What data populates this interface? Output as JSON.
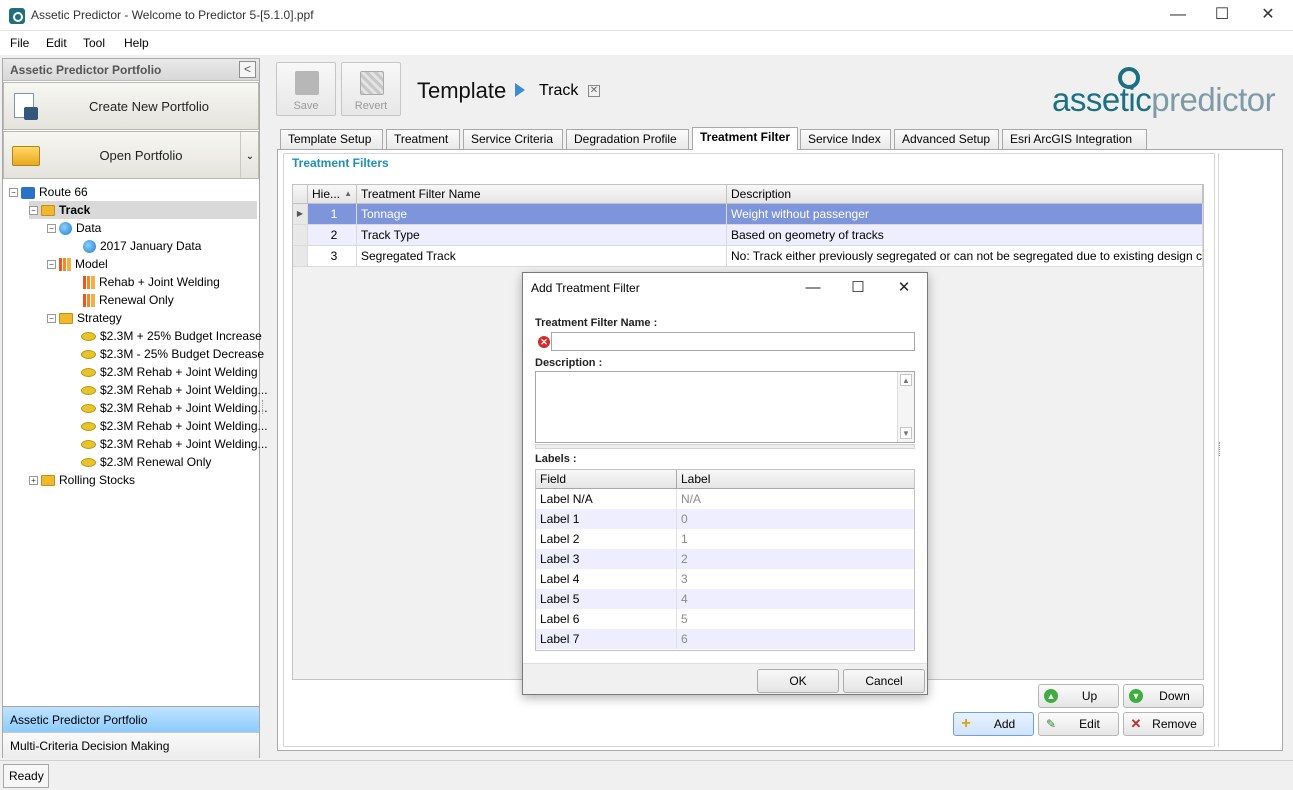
{
  "window": {
    "title": "Assetic Predictor - Welcome to Predictor 5-[5.1.0].ppf",
    "minimize": "—",
    "maximize": "☐",
    "close": "✕"
  },
  "menu": [
    "File",
    "Edit",
    "Tool",
    "Help"
  ],
  "left_panel": {
    "header": "Assetic Predictor Portfolio",
    "collapse_glyph": "<",
    "create_button": "Create New Portfolio",
    "open_button": "Open Portfolio",
    "tree": {
      "root": "Route 66",
      "track": "Track",
      "data": "Data",
      "data_item": "2017 January Data",
      "model": "Model",
      "model_items": [
        "Rehab + Joint Welding",
        "Renewal Only"
      ],
      "strategy": "Strategy",
      "strategy_items": [
        "$2.3M + 25% Budget Increase",
        "$2.3M - 25% Budget Decrease",
        "$2.3M Rehab + Joint Welding",
        "$2.3M Rehab + Joint Welding...",
        "$2.3M Rehab + Joint Welding...",
        "$2.3M Rehab + Joint Welding...",
        "$2.3M Rehab + Joint Welding...",
        "$2.3M Renewal Only"
      ],
      "rolling": "Rolling Stocks"
    },
    "nav": [
      "Assetic Predictor Portfolio",
      "Multi-Criteria Decision Making"
    ]
  },
  "toolbar": {
    "save": "Save",
    "revert": "Revert"
  },
  "breadcrumb": {
    "template": "Template",
    "item": "Track",
    "close": "✕"
  },
  "logo": {
    "part1": "assetic",
    "part2": "predictor"
  },
  "tabs": [
    "Template Setup",
    "Treatment",
    "Service Criteria",
    "Degradation Profile",
    "Treatment Filter",
    "Service Index",
    "Advanced Setup",
    "Esri ArcGIS Integration"
  ],
  "active_tab": "Treatment Filter",
  "section_title": "Treatment Filters",
  "grid": {
    "columns": [
      "Hie...",
      "Treatment Filter Name",
      "Description"
    ],
    "rows": [
      {
        "index": "1",
        "name": "Tonnage",
        "description": "Weight without passenger"
      },
      {
        "index": "2",
        "name": "Track Type",
        "description": "Based on geometry of tracks"
      },
      {
        "index": "3",
        "name": "Segregated Track",
        "description": "No: Track either previously segregated or can not be segregated due to existing design constr..."
      }
    ]
  },
  "buttons": {
    "up": "Up",
    "down": "Down",
    "add": "Add",
    "edit": "Edit",
    "remove": "Remove"
  },
  "status": "Ready",
  "dialog": {
    "title": "Add Treatment Filter",
    "name_label": "Treatment Filter Name :",
    "name_value": "",
    "description_label": "Description :",
    "description_value": "",
    "labels_label": "Labels :",
    "labels_columns": [
      "Field",
      "Label"
    ],
    "labels": [
      {
        "field": "Label N/A",
        "label": "N/A"
      },
      {
        "field": "Label 1",
        "label": "0"
      },
      {
        "field": "Label 2",
        "label": "1"
      },
      {
        "field": "Label 3",
        "label": "2"
      },
      {
        "field": "Label 4",
        "label": "3"
      },
      {
        "field": "Label 5",
        "label": "4"
      },
      {
        "field": "Label 6",
        "label": "5"
      },
      {
        "field": "Label 7",
        "label": "6"
      }
    ],
    "ok": "OK",
    "cancel": "Cancel"
  },
  "colors": {
    "accent_blue": "#1f8fb4",
    "selected_row": "#7f95db",
    "alt_row": "#eeeeff",
    "logo_teal": "#1d6f82",
    "logo_grey": "#7d9ba6"
  }
}
